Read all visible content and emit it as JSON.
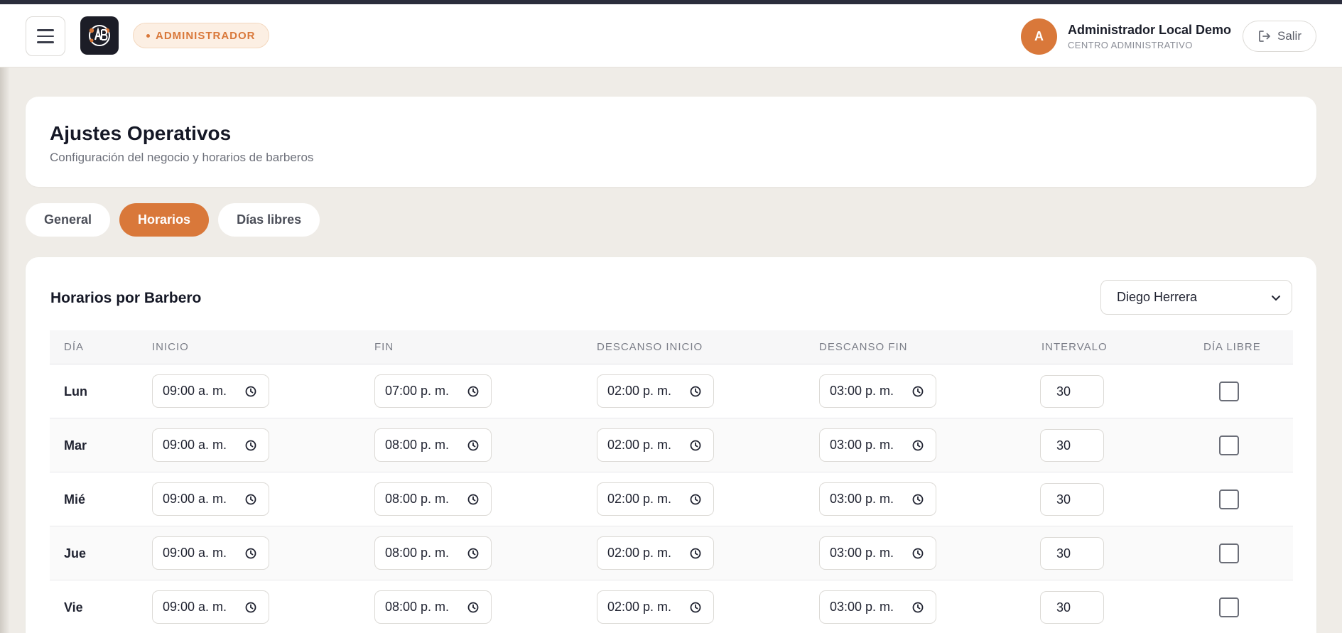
{
  "header": {
    "role_badge": "ADMINISTRADOR",
    "avatar_initial": "A",
    "user_name": "Administrador Local Demo",
    "user_role": "CENTRO ADMINISTRATIVO",
    "logout_label": "Salir"
  },
  "page": {
    "title": "Ajustes Operativos",
    "subtitle": "Configuración del negocio y horarios de barberos"
  },
  "tabs": [
    {
      "label": "General",
      "active": false
    },
    {
      "label": "Horarios",
      "active": true
    },
    {
      "label": "Días libres",
      "active": false
    }
  ],
  "schedule": {
    "title": "Horarios por Barbero",
    "selected_barber": "Diego Herrera",
    "columns": [
      "DÍA",
      "INICIO",
      "FIN",
      "DESCANSO INICIO",
      "DESCANSO FIN",
      "INTERVALO",
      "DÍA LIBRE"
    ],
    "rows": [
      {
        "day": "Lun",
        "start": "09:00  a. m.",
        "end": "07:00  p. m.",
        "break_start": "02:00  p. m.",
        "break_end": "03:00  p. m.",
        "interval": "30",
        "day_off": false
      },
      {
        "day": "Mar",
        "start": "09:00  a. m.",
        "end": "08:00  p. m.",
        "break_start": "02:00  p. m.",
        "break_end": "03:00  p. m.",
        "interval": "30",
        "day_off": false
      },
      {
        "day": "Mié",
        "start": "09:00  a. m.",
        "end": "08:00  p. m.",
        "break_start": "02:00  p. m.",
        "break_end": "03:00  p. m.",
        "interval": "30",
        "day_off": false
      },
      {
        "day": "Jue",
        "start": "09:00  a. m.",
        "end": "08:00  p. m.",
        "break_start": "02:00  p. m.",
        "break_end": "03:00  p. m.",
        "interval": "30",
        "day_off": false
      },
      {
        "day": "Vie",
        "start": "09:00  a. m.",
        "end": "08:00  p. m.",
        "break_start": "02:00  p. m.",
        "break_end": "03:00  p. m.",
        "interval": "30",
        "day_off": false
      }
    ]
  },
  "colors": {
    "accent": "#d9783a",
    "topbar": "#2b2d3c",
    "background": "#efece7"
  },
  "icons": [
    "menu-icon",
    "logo-icon",
    "logout-icon",
    "chevron-down-icon",
    "clock-icon"
  ]
}
